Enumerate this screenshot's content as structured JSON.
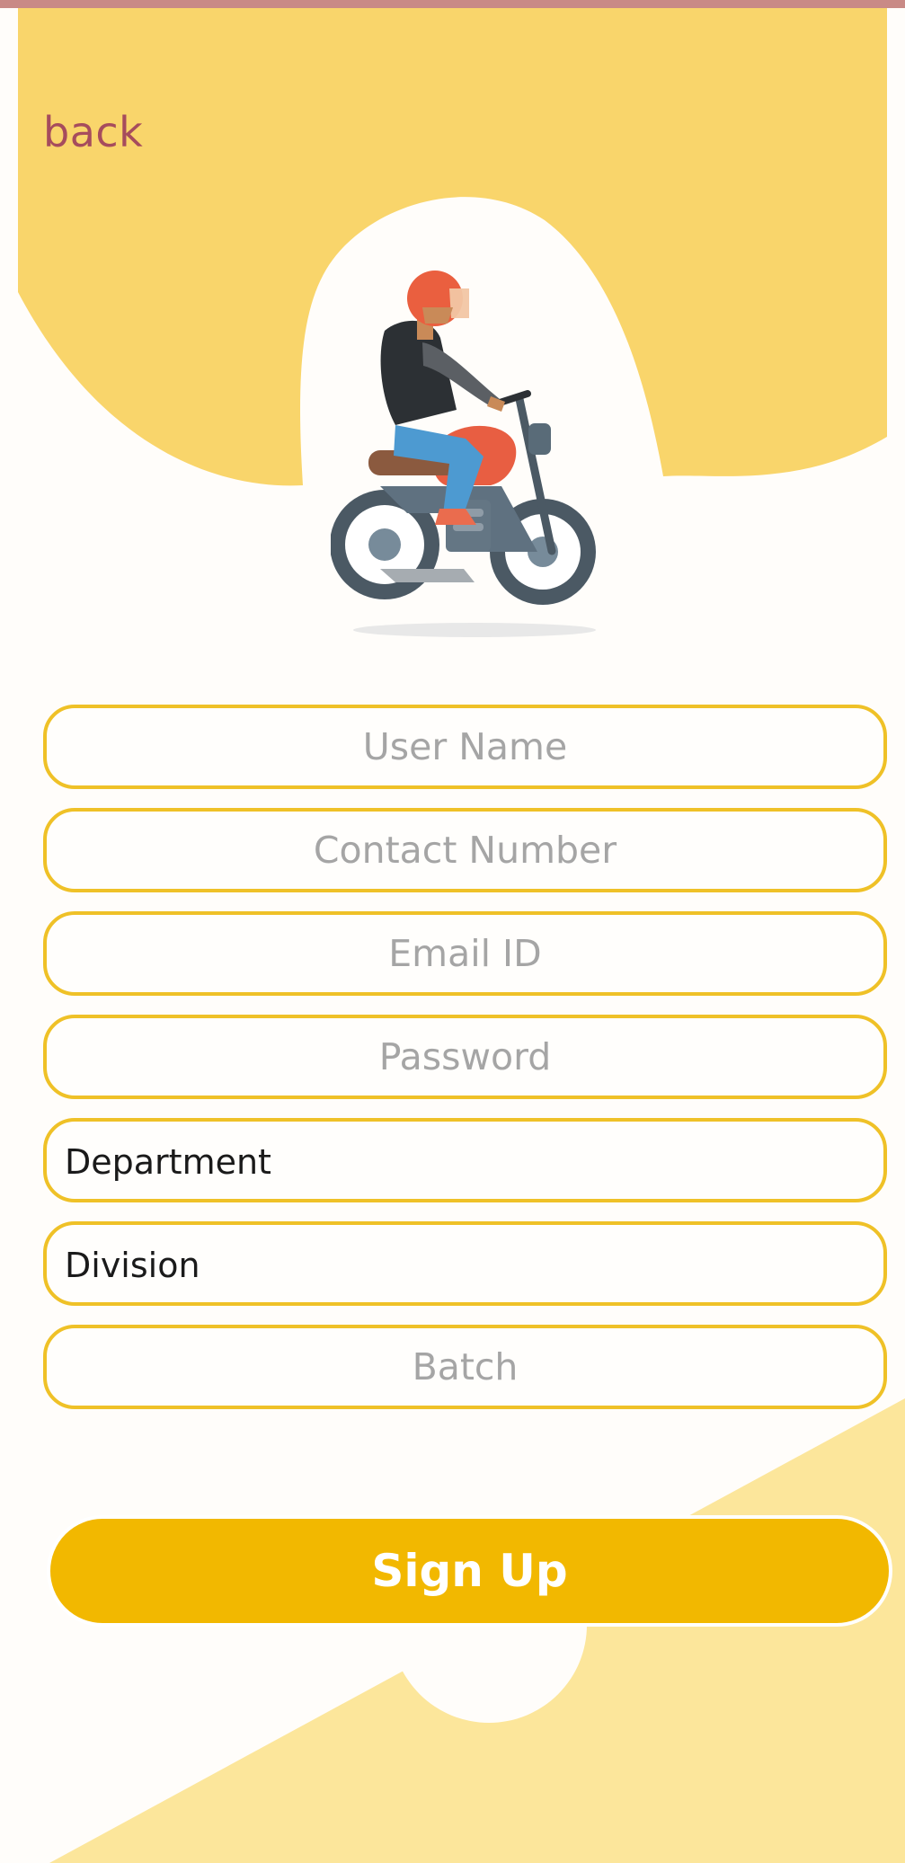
{
  "colors": {
    "header_yellow": "#f9d56b",
    "border_yellow": "#efc127",
    "button_yellow": "#f2b800",
    "back_text": "#a64c5d",
    "placeholder_text": "#a5a5a5",
    "light_yellow": "#fce69b"
  },
  "header": {
    "back_label": "back"
  },
  "illustration": {
    "icon": "motorcycle-rider-icon"
  },
  "form": {
    "user_name": {
      "placeholder": "User Name",
      "value": ""
    },
    "contact_number": {
      "placeholder": "Contact Number",
      "value": ""
    },
    "email_id": {
      "placeholder": "Email ID",
      "value": ""
    },
    "password": {
      "placeholder": "Password",
      "value": ""
    },
    "department": {
      "selected": "Department"
    },
    "division": {
      "selected": "Division"
    },
    "batch": {
      "placeholder": "Batch",
      "value": ""
    },
    "submit_label": "Sign Up"
  }
}
